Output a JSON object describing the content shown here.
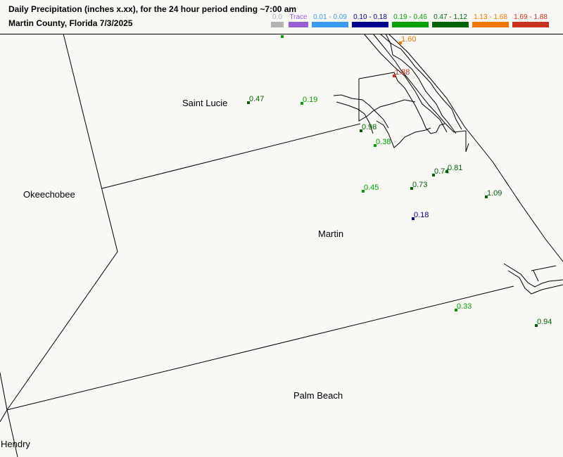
{
  "title_line1": "Daily Precipitation (inches  x.xx),  for the 24 hour period ending ~7:00 am",
  "title_line2": "Martin County, Florida  7/3/2025",
  "legend": [
    {
      "label": "0.0",
      "color": "#b2b2b2"
    },
    {
      "label": "Trace",
      "color": "#9b5fd4"
    },
    {
      "label": "0.01 - 0.09",
      "color": "#3a9bf2"
    },
    {
      "label": "0.10 - 0.18",
      "color": "#00008c"
    },
    {
      "label": "0.19 - 0.46",
      "color": "#00a000"
    },
    {
      "label": "0.47 - 1.12",
      "color": "#006400"
    },
    {
      "label": "1.13 - 1.68",
      "color": "#f07800"
    },
    {
      "label": "1.69 - 1.88",
      "color": "#c8321e"
    }
  ],
  "counties": [
    "Saint Lucie",
    "Okeechobee",
    "Martin",
    "Palm Beach",
    "Hendry"
  ],
  "stations": [
    {
      "value": "1.60",
      "color": "#f07800"
    },
    {
      "value": "1.88",
      "color": "#c8321e"
    },
    {
      "value": "0.47",
      "color": "#006400"
    },
    {
      "value": "0.19",
      "color": "#00a000"
    },
    {
      "value": "0.98",
      "color": "#006400"
    },
    {
      "value": "0.38",
      "color": "#00a000"
    },
    {
      "value": "0.74",
      "color": "#006400"
    },
    {
      "value": "0.81",
      "color": "#006400"
    },
    {
      "value": "0.45",
      "color": "#00a000"
    },
    {
      "value": "0.73",
      "color": "#006400"
    },
    {
      "value": "1.09",
      "color": "#006400"
    },
    {
      "value": "0.18",
      "color": "#00008c"
    },
    {
      "value": "0.33",
      "color": "#00a000"
    },
    {
      "value": "0.94",
      "color": "#006400"
    },
    {
      "value": "",
      "color": "#00a000"
    }
  ]
}
